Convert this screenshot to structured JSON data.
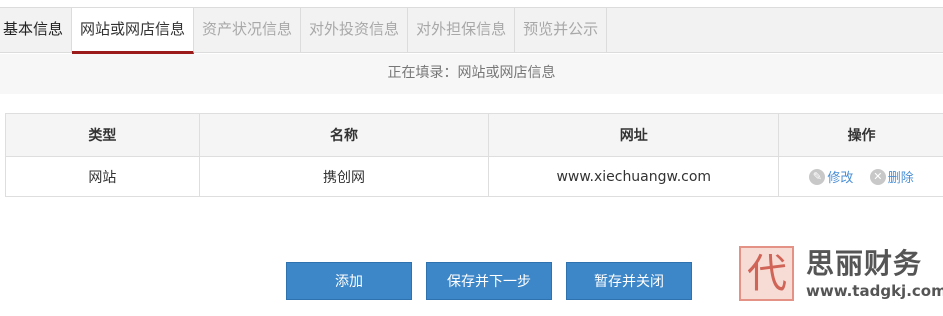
{
  "tabs": [
    {
      "label": "基本信息",
      "state": "done"
    },
    {
      "label": "网站或网店信息",
      "state": "active"
    },
    {
      "label": "资产状况信息",
      "state": "pending"
    },
    {
      "label": "对外投资信息",
      "state": "pending"
    },
    {
      "label": "对外担保信息",
      "state": "pending"
    },
    {
      "label": "预览并公示",
      "state": "pending"
    }
  ],
  "notice": "正在填录：网站或网店信息",
  "table": {
    "headers": [
      "类型",
      "名称",
      "网址",
      "操作"
    ],
    "rows": [
      {
        "type": "网站",
        "name": "携创网",
        "url": "www.xiechuangw.com",
        "edit": "修改",
        "delete": "删除"
      }
    ]
  },
  "buttons": {
    "add": "添加",
    "save_next": "保存并下一步",
    "save_close": "暂存并关闭"
  },
  "watermark": {
    "seal": "代",
    "name": "思丽财务",
    "url": "www.tadgkj.com"
  },
  "colors": {
    "accent": "#3d86c8",
    "active_tab_underline": "#9b1b1b",
    "link": "#4a8fd6"
  },
  "icons": {
    "edit": "pencil-icon",
    "delete": "close-circle-icon"
  }
}
